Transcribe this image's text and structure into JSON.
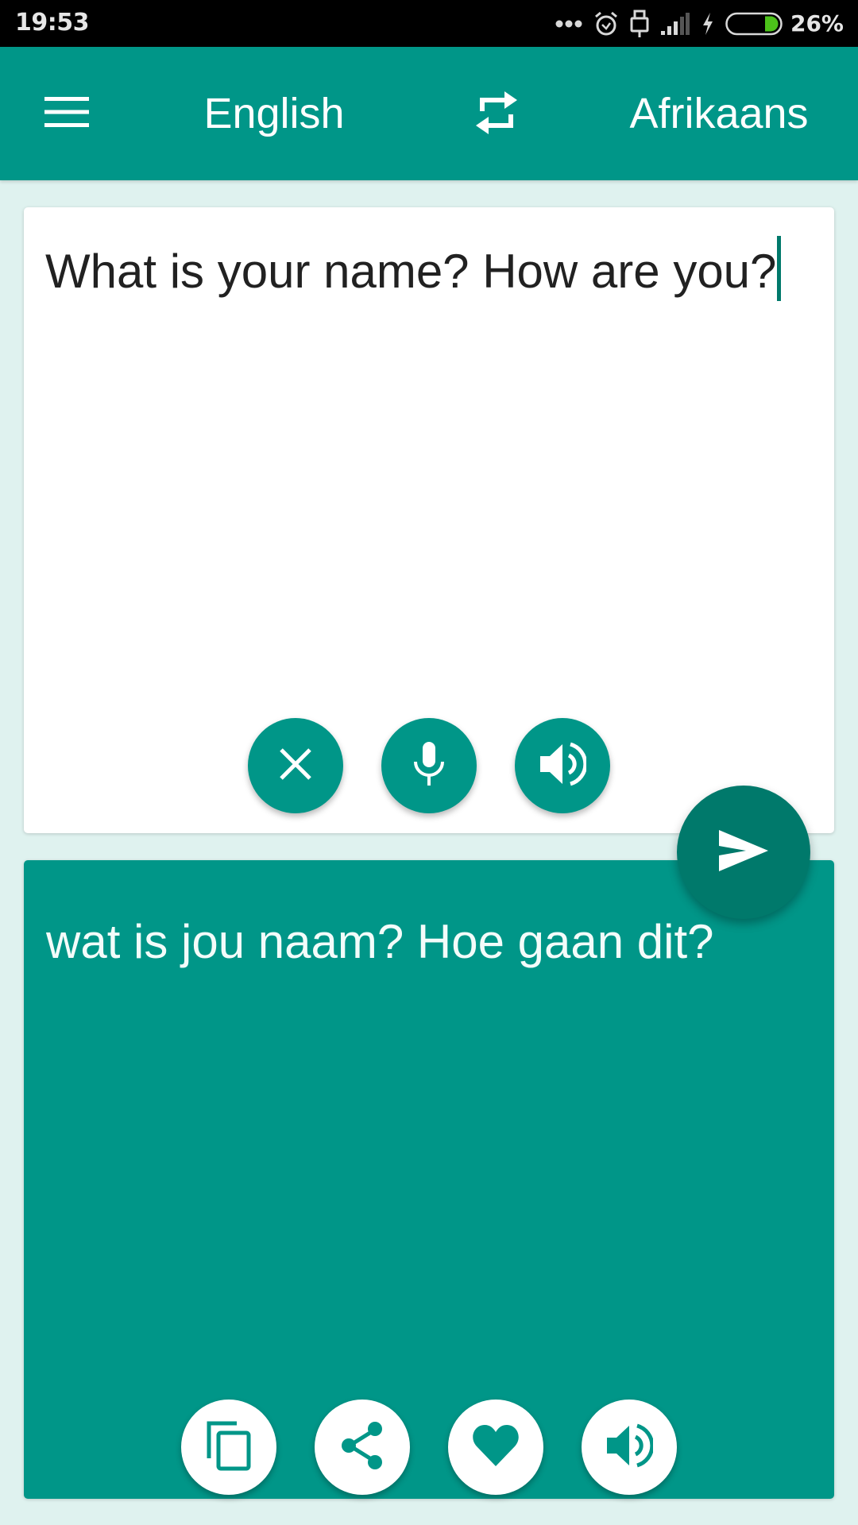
{
  "status_bar": {
    "time": "19:53",
    "icons": [
      "more-dots-icon",
      "alarm-icon",
      "usb-icon",
      "signal-icon",
      "charging-bolt-icon",
      "battery-icon"
    ],
    "battery_percent": "26%",
    "battery_level": 0.26,
    "battery_fill_color": "#4cc21a"
  },
  "app_bar": {
    "menu_icon": "hamburger-menu-icon",
    "source_language": "English",
    "swap_icon": "swap-languages-icon",
    "target_language": "Afrikaans",
    "background_color": "#009688"
  },
  "input": {
    "text": "What is your name? How are you?",
    "buttons": [
      {
        "name": "clear-button",
        "icon": "close-icon"
      },
      {
        "name": "voice-input-button",
        "icon": "microphone-icon"
      },
      {
        "name": "speak-source-button",
        "icon": "speaker-icon"
      }
    ]
  },
  "translate_button": {
    "icon": "send-icon",
    "color": "#00796b"
  },
  "output": {
    "text": "wat is jou naam? Hoe gaan dit?",
    "buttons": [
      {
        "name": "copy-button",
        "icon": "copy-icon"
      },
      {
        "name": "share-button",
        "icon": "share-icon"
      },
      {
        "name": "favorite-button",
        "icon": "heart-icon"
      },
      {
        "name": "speak-translation-button",
        "icon": "speaker-icon"
      }
    ]
  },
  "colors": {
    "accent": "#009688",
    "accent_dark": "#00796b",
    "background": "#dff2ef",
    "text_primary": "#212121"
  }
}
